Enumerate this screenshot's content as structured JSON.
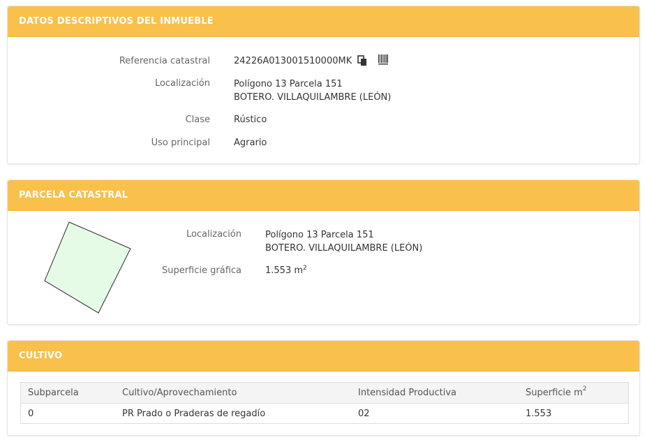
{
  "sections": {
    "datos": {
      "title": "DATOS DESCRIPTIVOS DEL INMUEBLE",
      "referencia_label": "Referencia catastral",
      "referencia_value": "24226A013001510000MK",
      "localizacion_label": "Localización",
      "localizacion_line1": "Polígono 13 Parcela 151",
      "localizacion_line2": "BOTERO. VILLAQUILAMBRE (LEÓN)",
      "clase_label": "Clase",
      "clase_value": "Rústico",
      "uso_label": "Uso principal",
      "uso_value": "Agrario"
    },
    "parcela": {
      "title": "PARCELA CATASTRAL",
      "localizacion_label": "Localización",
      "localizacion_line1": "Polígono 13 Parcela 151",
      "localizacion_line2": "BOTERO. VILLAQUILAMBRE (LEÓN)",
      "superficie_label": "Superficie gráfica",
      "superficie_value": "1.553 m",
      "superficie_unit_exp": "2"
    },
    "cultivo": {
      "title": "CULTIVO",
      "headers": {
        "subparcela": "Subparcela",
        "cultivo": "Cultivo/Aprovechamiento",
        "intensidad": "Intensidad Productiva",
        "superficie": "Superficie m",
        "superficie_exp": "2"
      },
      "rows": [
        {
          "subparcela": "0",
          "cultivo": "PR Prado o Praderas de regadío",
          "intensidad": "02",
          "superficie": "1.553"
        }
      ]
    }
  },
  "icons": {
    "copy": "copy-icon",
    "barcode": "barcode-icon"
  },
  "colors": {
    "header_bg": "#f9c14b",
    "parcel_fill": "#e6fbe6",
    "parcel_stroke": "#2b2b2b"
  }
}
